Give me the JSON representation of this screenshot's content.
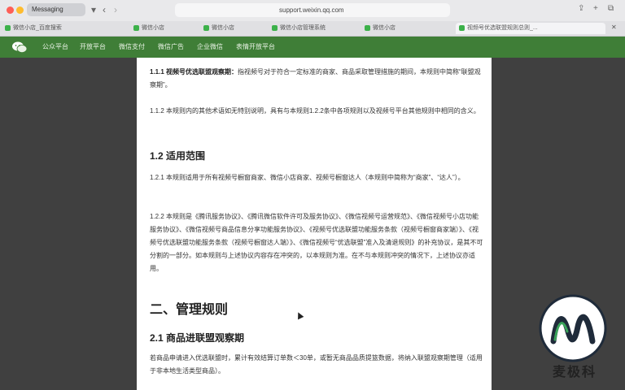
{
  "browser": {
    "active_tab_title": "Messaging",
    "url": "support.weixin.qq.com",
    "tabs": [
      {
        "label": "微信小店_百度搜索"
      },
      {
        "label": "微信小店"
      },
      {
        "label": "微信小店"
      },
      {
        "label": "微信小店管理系统"
      },
      {
        "label": "微信小店"
      },
      {
        "label": "视频号优选联盟规则总则_..."
      }
    ]
  },
  "site_nav": {
    "items": [
      "公众平台",
      "开放平台",
      "微信支付",
      "微信广告",
      "企业微信",
      "表情开放平台"
    ]
  },
  "article": {
    "p1_bold": "1.1.1 视频号优选联盟观察期：",
    "p1_text": "指视频号对于符合一定标准的商家、商品采取管理措施的期间，本规则中简称“联盟观察期”。",
    "p2": "1.1.2 本规则内的其他术语如无特别说明，具有与本规则1.2.2条中各项规则以及视频号平台其他规则中相同的含义。",
    "h_scope": "1.2 适用范围",
    "p3": "1.2.1 本规则适用于所有视频号橱窗商家、微信小店商家、视频号橱窗达人（本规则中简称为“商家”、“达人”）。",
    "p4": "1.2.2 本规则是《腾讯服务协议》、《腾讯微信软件许可及服务协议》、《微信视频号运营规范》、《微信视频号小店功能服务协议》、《微信视频号商品信息分享功能服务协议》、《视频号优选联盟功能服务条款（视频号橱窗商家端）》、《视频号优选联盟功能服务条款（视频号橱窗达人端）》、《微信视频号“优选联盟”准入及清退规则》的补充协议，是其不可分割的一部分。如本规则与上述协议内容存在冲突的，以本规则为准。在不与本规则冲突的情况下，上述协议亦适用。",
    "h_mgmt": "二、管理规则",
    "h_observe": "2.1 商品进联盟观察期",
    "p5": "若商品申请进入优选联盟时，累计有效结算订单数＜30单，或暂无商品品质提篮数据，将纳入联盟观察期管理（适用于非本地生活类型商品）。"
  },
  "watermark": {
    "text": "麦极科"
  },
  "colors": {
    "nav_green": "#3f7e37",
    "chrome": "#e9e9eb",
    "side_dark": "#404040"
  }
}
